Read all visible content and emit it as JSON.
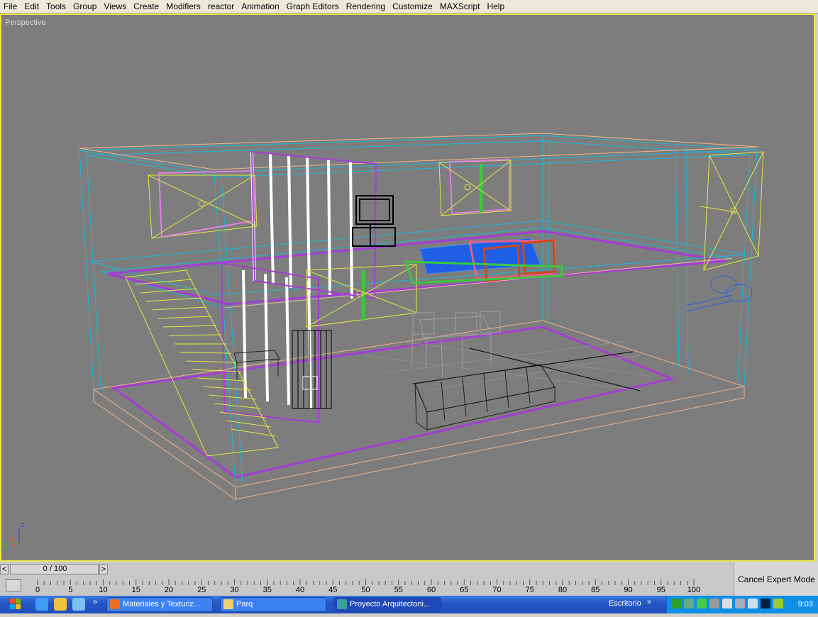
{
  "menu": [
    "File",
    "Edit",
    "Tools",
    "Group",
    "Views",
    "Create",
    "Modifiers",
    "reactor",
    "Animation",
    "Graph Editors",
    "Rendering",
    "Customize",
    "MAXScript",
    "Help"
  ],
  "viewport": {
    "label": "Perspective",
    "axis_z": "z",
    "axis_x": "x",
    "axis_y": "y"
  },
  "timeline": {
    "frame_display": "0 / 100",
    "prev_label": "<",
    "next_label": ">",
    "ticks": [
      "0",
      "5",
      "10",
      "15",
      "20",
      "25",
      "30",
      "35",
      "40",
      "45",
      "50",
      "55",
      "60",
      "65",
      "70",
      "75",
      "80",
      "85",
      "90",
      "95",
      "100"
    ]
  },
  "cancel_expert_label": "Cancel Expert Mode",
  "taskbar": {
    "quicklaunch_more": "»",
    "tasks": [
      {
        "label": "Materiales y Texturiz...",
        "icon": "firefox-icon"
      },
      {
        "label": "Parq",
        "icon": "folder-icon"
      },
      {
        "label": "Proyecto Arquitectoni...",
        "icon": "3dsmax-icon"
      }
    ],
    "toolbar_label": "Escritorio",
    "toolbar_more": "»",
    "clock": "9:03"
  },
  "colors": {
    "viewport_bg": "#7d7d7d",
    "active_border": "#e8e84a",
    "cyan": "#19b8d6",
    "magenta": "#a63cd6",
    "peach": "#f0b48c",
    "yellow": "#e6e640",
    "blue_bed": "#1e5fe6",
    "green": "#3cc83c"
  }
}
